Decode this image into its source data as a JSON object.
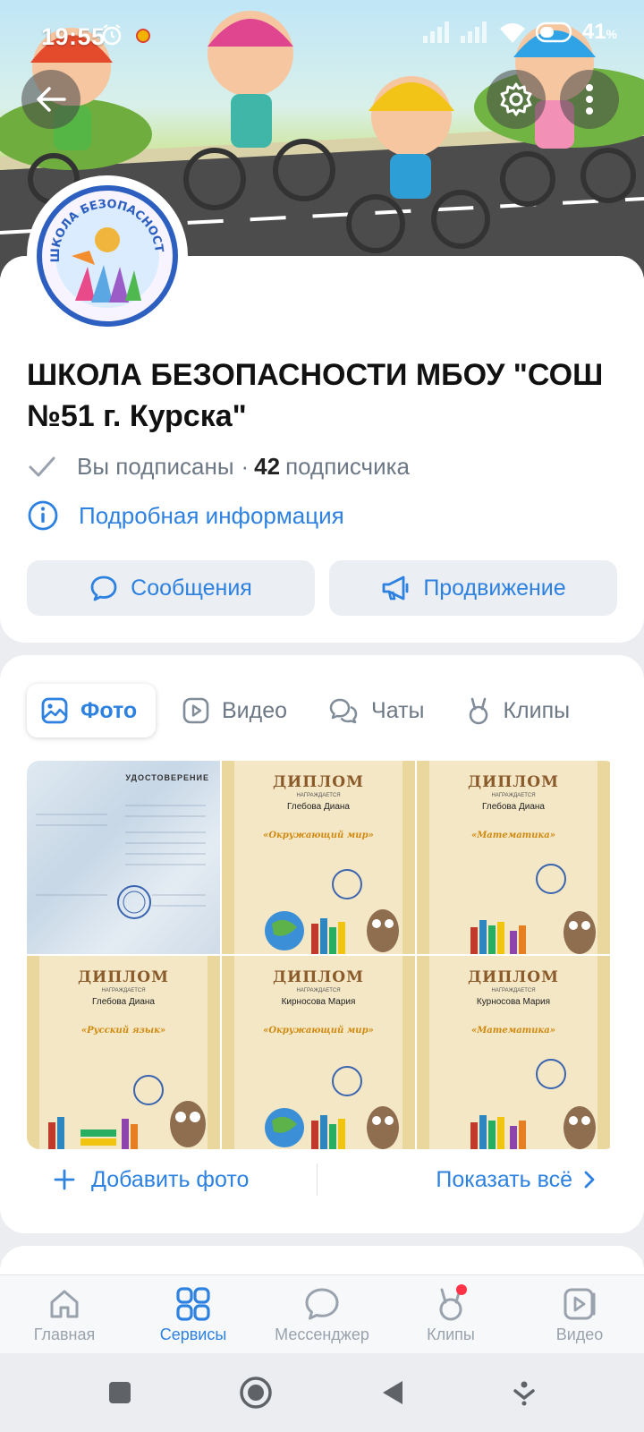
{
  "status_bar": {
    "time": "19:55",
    "battery": "41",
    "battery_unit": "%"
  },
  "group": {
    "title": "ШКОЛА БЕЗОПАСНОСТИ МБОУ \"СОШ №51 г. Курска\"",
    "subscribed_label": "Вы подписаны",
    "separator": "·",
    "subscriber_count": "42",
    "subscriber_word": "подписчика",
    "info_link": "Подробная информация",
    "avatar_text": "ШКОЛА БЕЗОПАСНОСТИ"
  },
  "actions": {
    "messages": "Сообщения",
    "promotion": "Продвижение"
  },
  "tabs": [
    {
      "label": "Фото",
      "icon": "image-icon",
      "active": true
    },
    {
      "label": "Видео",
      "icon": "video-icon"
    },
    {
      "label": "Чаты",
      "icon": "chats-icon"
    },
    {
      "label": "Клипы",
      "icon": "clips-icon"
    }
  ],
  "photos": [
    {
      "kind": "certificate",
      "title": "УДОСТОВЕРЕНИЕ"
    },
    {
      "kind": "diploma",
      "title": "ДИПЛОМ",
      "awarded": "НАГРАЖДАЕТСЯ",
      "name": "Глебова Диана",
      "subject": "«Окружающий мир»"
    },
    {
      "kind": "diploma",
      "title": "ДИПЛОМ",
      "awarded": "НАГРАЖДАЕТСЯ",
      "name": "Глебова Диана",
      "subject": "«Математика»"
    },
    {
      "kind": "diploma",
      "title": "ДИПЛОМ",
      "awarded": "НАГРАЖДАЕТСЯ",
      "name": "Глебова Диана",
      "subject": "«Русский язык»"
    },
    {
      "kind": "diploma",
      "title": "ДИПЛОМ",
      "awarded": "НАГРАЖДАЕТСЯ",
      "name": "Кирносова Мария",
      "subject": "«Окружающий мир»"
    },
    {
      "kind": "diploma",
      "title": "ДИПЛОМ",
      "awarded": "НАГРАЖДАЕТСЯ",
      "name": "Курносова Мария",
      "subject": "«Математика»"
    }
  ],
  "media_footer": {
    "add_photo": "Добавить фото",
    "show_all": "Показать всё"
  },
  "bottom_nav": [
    {
      "label": "Главная",
      "icon": "home-icon"
    },
    {
      "label": "Сервисы",
      "icon": "services-icon",
      "active": true
    },
    {
      "label": "Мессенджер",
      "icon": "messenger-icon"
    },
    {
      "label": "Клипы",
      "icon": "clips-icon",
      "badge": true
    },
    {
      "label": "Видео",
      "icon": "video-icon"
    }
  ],
  "colors": {
    "accent": "#2d81e0",
    "muted": "#6d7885",
    "badge": "#ff3347"
  }
}
